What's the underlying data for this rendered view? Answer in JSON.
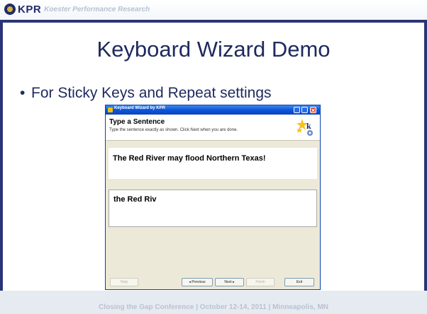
{
  "header": {
    "logo_text": "KPR",
    "logo_subtitle": "Koester Performance Research"
  },
  "slide": {
    "title": "Keyboard Wizard Demo",
    "bullet": "For Sticky Keys and Repeat settings",
    "bullet_marker": "•"
  },
  "wizard": {
    "window_title": "Keyboard Wizard by KPR",
    "heading": "Type a Sentence",
    "instructions": "Type the sentence exactly as shown. Click Next when you are done.",
    "target_sentence": "The Red River may flood Northern Texas!",
    "typed_text": "the Red Riv",
    "buttons": {
      "help": "Help",
      "previous": "◂ Previous",
      "next": "Next ▸",
      "finish": "Finish",
      "exit": "Exit"
    }
  },
  "footer": {
    "text": "Closing the Gap Conference | October 12-14, 2011 | Minneapolis, MN"
  },
  "colors": {
    "accent": "#2a3577",
    "titlebar": "#0e54d8"
  }
}
